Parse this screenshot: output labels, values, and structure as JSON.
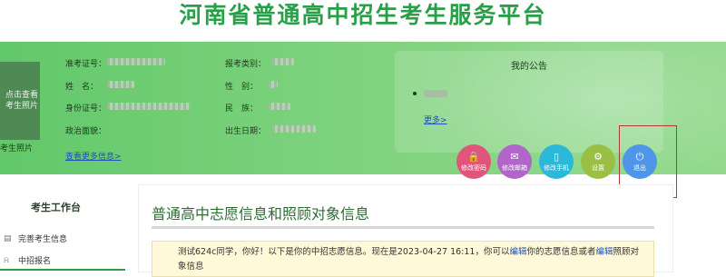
{
  "site": {
    "title": "河南省普通高中招生考生服务平台"
  },
  "profile": {
    "photo_placeholder": "点击查看考生照片",
    "photo_caption": "考生照片",
    "fields": [
      {
        "label": "准考证号："
      },
      {
        "label": "报考类别："
      },
      {
        "label": "姓　名："
      },
      {
        "label": "性　别："
      },
      {
        "label": "身份证号："
      },
      {
        "label": "民　族："
      },
      {
        "label": "政治面貌："
      },
      {
        "label": "出生日期："
      }
    ],
    "more_link": "查看更多信息>"
  },
  "notice": {
    "title": "我的公告",
    "more_link": "更多>"
  },
  "actions": [
    {
      "label": "修改密码",
      "icon": "lock-icon",
      "glyph": "🔒",
      "color": "#e2557a"
    },
    {
      "label": "修改邮箱",
      "icon": "mail-icon",
      "glyph": "✉",
      "color": "#b165c9"
    },
    {
      "label": "修改手机",
      "icon": "phone-icon",
      "glyph": "▯",
      "color": "#2bb8d9"
    },
    {
      "label": "设置",
      "icon": "gear-icon",
      "glyph": "⚙",
      "color": "#9bbf45"
    },
    {
      "label": "退出",
      "icon": "power-icon",
      "glyph": "⏻",
      "color": "#4f96e8"
    }
  ],
  "sidebar": {
    "title": "考生工作台",
    "items": [
      {
        "label": "完善考生信息",
        "icon": "id-card-icon",
        "glyph": "▤"
      },
      {
        "label": "中招报名",
        "icon": "bell-icon",
        "glyph": "⍾"
      }
    ]
  },
  "main": {
    "title": "普通高中志愿信息和照顾对象信息",
    "message": {
      "before": "测试624c同学，你好！以下是你的中招志愿信息。现在是2023-04-27 16:11，你可以",
      "link1": "编辑",
      "middle": "你的志愿信息或者",
      "link2": "编辑",
      "after": "照顾对象信息"
    }
  },
  "colors": {
    "title_green": "#2a9f49",
    "banner_green": "#7dd27d",
    "link_blue": "#1f4fb8",
    "annotation_red": "#b03a3a"
  }
}
